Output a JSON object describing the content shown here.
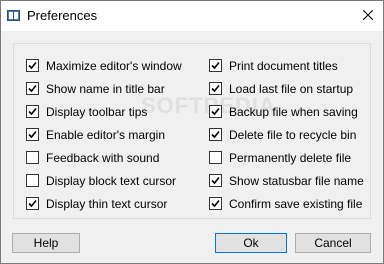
{
  "window": {
    "title": "Preferences",
    "icon": "book-icon",
    "close_glyph": "✕"
  },
  "options_left": [
    {
      "label": "Maximize editor's window",
      "checked": true
    },
    {
      "label": "Show name in title bar",
      "checked": true
    },
    {
      "label": "Display toolbar tips",
      "checked": true
    },
    {
      "label": "Enable editor's margin",
      "checked": true
    },
    {
      "label": "Feedback with sound",
      "checked": false
    },
    {
      "label": "Display block text cursor",
      "checked": false
    },
    {
      "label": "Display thin text cursor",
      "checked": true
    }
  ],
  "options_right": [
    {
      "label": "Print document titles",
      "checked": true
    },
    {
      "label": "Load last file on startup",
      "checked": true
    },
    {
      "label": "Backup file when saving",
      "checked": true
    },
    {
      "label": "Delete file to recycle bin",
      "checked": true
    },
    {
      "label": "Permanently delete file",
      "checked": false
    },
    {
      "label": "Show statusbar file name",
      "checked": true
    },
    {
      "label": "Confirm save existing file",
      "checked": true
    }
  ],
  "buttons": {
    "help": "Help",
    "ok": "Ok",
    "cancel": "Cancel"
  },
  "watermark": "SOFTPEDIA",
  "colors": {
    "accent": "#0078d7",
    "background": "#f0f0f0"
  }
}
